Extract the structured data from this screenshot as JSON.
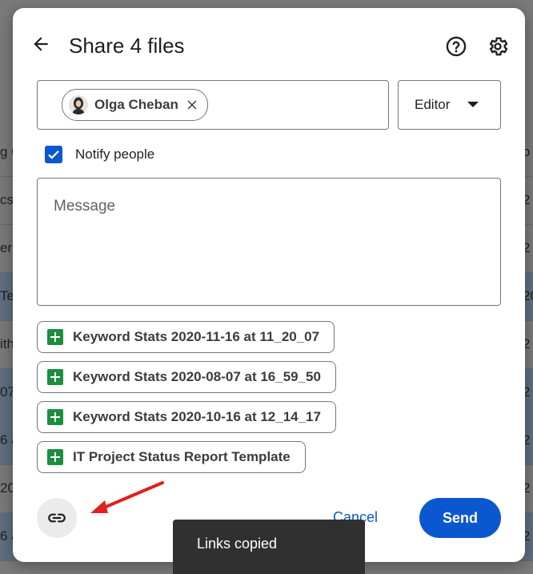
{
  "background": {
    "rows": [
      {
        "left": "g G",
        "right": "o",
        "selected": false
      },
      {
        "left": "cs",
        "right": "2",
        "selected": false
      },
      {
        "left": "er?",
        "right": "2",
        "selected": false
      },
      {
        "left": "Te",
        "right": "20",
        "selected": true
      },
      {
        "left": "ith",
        "right": "2",
        "selected": false
      },
      {
        "left": "07",
        "right": "2",
        "selected": true
      },
      {
        "left": "6 a",
        "right": "2",
        "selected": true
      },
      {
        "left": "20",
        "right": "2",
        "selected": false
      },
      {
        "left": "6 a",
        "right": "2",
        "selected": true
      }
    ]
  },
  "dialog": {
    "title": "Share 4 files",
    "recipient": {
      "name": "Olga Cheban"
    },
    "role": "Editor",
    "notify_label": "Notify people",
    "notify_checked": true,
    "message_placeholder": "Message",
    "files": [
      "Keyword Stats 2020-11-16 at 11_20_07",
      "Keyword Stats 2020-08-07 at 16_59_50",
      "Keyword Stats 2020-10-16 at 12_14_17",
      "IT Project Status Report Template"
    ],
    "cancel_label": "Cancel",
    "send_label": "Send"
  },
  "toast": {
    "text": "Links copied"
  },
  "colors": {
    "accent": "#0b57d0",
    "sheets_green": "#1e8e3e",
    "annotation_arrow": "#e02020"
  }
}
